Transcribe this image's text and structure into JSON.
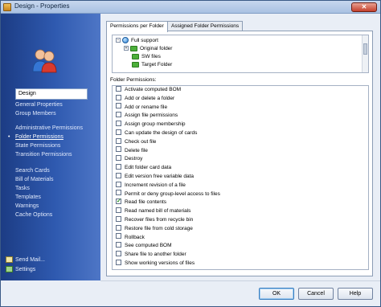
{
  "window": {
    "title": "Design - Properties",
    "close_glyph": "✕"
  },
  "sidebar": {
    "name_value": "Design",
    "groups": [
      [
        "General Properties",
        "Group Members"
      ],
      [
        "Administrative Permissions",
        "Folder Permissions",
        "State Permissions",
        "Transition Permissions"
      ],
      [
        "Search Cards",
        "Bill of Materials",
        "Tasks",
        "Templates",
        "Warnings",
        "Cache Options"
      ]
    ],
    "active_item": "Folder Permissions",
    "active_bullet": "•",
    "bottom": [
      "Send Mail...",
      "Settings"
    ]
  },
  "tabs": [
    "Permissions per Folder",
    "Assigned Folder Permissions"
  ],
  "tree": {
    "root": "Full support",
    "children": [
      "Original folder",
      "SW files",
      "Target Folder"
    ],
    "collapse_glyph": "−",
    "expand_glyph": "+"
  },
  "perms_label": "Folder Permissions:",
  "permissions": [
    {
      "label": "Activate computed BOM",
      "checked": false
    },
    {
      "label": "Add or delete a folder",
      "checked": false
    },
    {
      "label": "Add or rename file",
      "checked": false
    },
    {
      "label": "Assign file permissions",
      "checked": false
    },
    {
      "label": "Assign group membership",
      "checked": false
    },
    {
      "label": "Can update the design of cards",
      "checked": false
    },
    {
      "label": "Check out file",
      "checked": false
    },
    {
      "label": "Delete file",
      "checked": false
    },
    {
      "label": "Destroy",
      "checked": false
    },
    {
      "label": "Edit folder card data",
      "checked": false
    },
    {
      "label": "Edit version free variable data",
      "checked": false
    },
    {
      "label": "Increment revision of a file",
      "checked": false
    },
    {
      "label": "Permit or deny group-level access to files",
      "checked": false
    },
    {
      "label": "Read file contents",
      "checked": true
    },
    {
      "label": "Read named bill of materials",
      "checked": false
    },
    {
      "label": "Recover files from recycle bin",
      "checked": false
    },
    {
      "label": "Restore file from cold storage",
      "checked": false
    },
    {
      "label": "Rollback",
      "checked": false
    },
    {
      "label": "See computed BOM",
      "checked": false
    },
    {
      "label": "Share file to another folder",
      "checked": false
    },
    {
      "label": "Show working versions of files",
      "checked": false
    }
  ],
  "checkmark_glyph": "✓",
  "buttons": {
    "ok": "OK",
    "cancel": "Cancel",
    "help": "Help"
  }
}
